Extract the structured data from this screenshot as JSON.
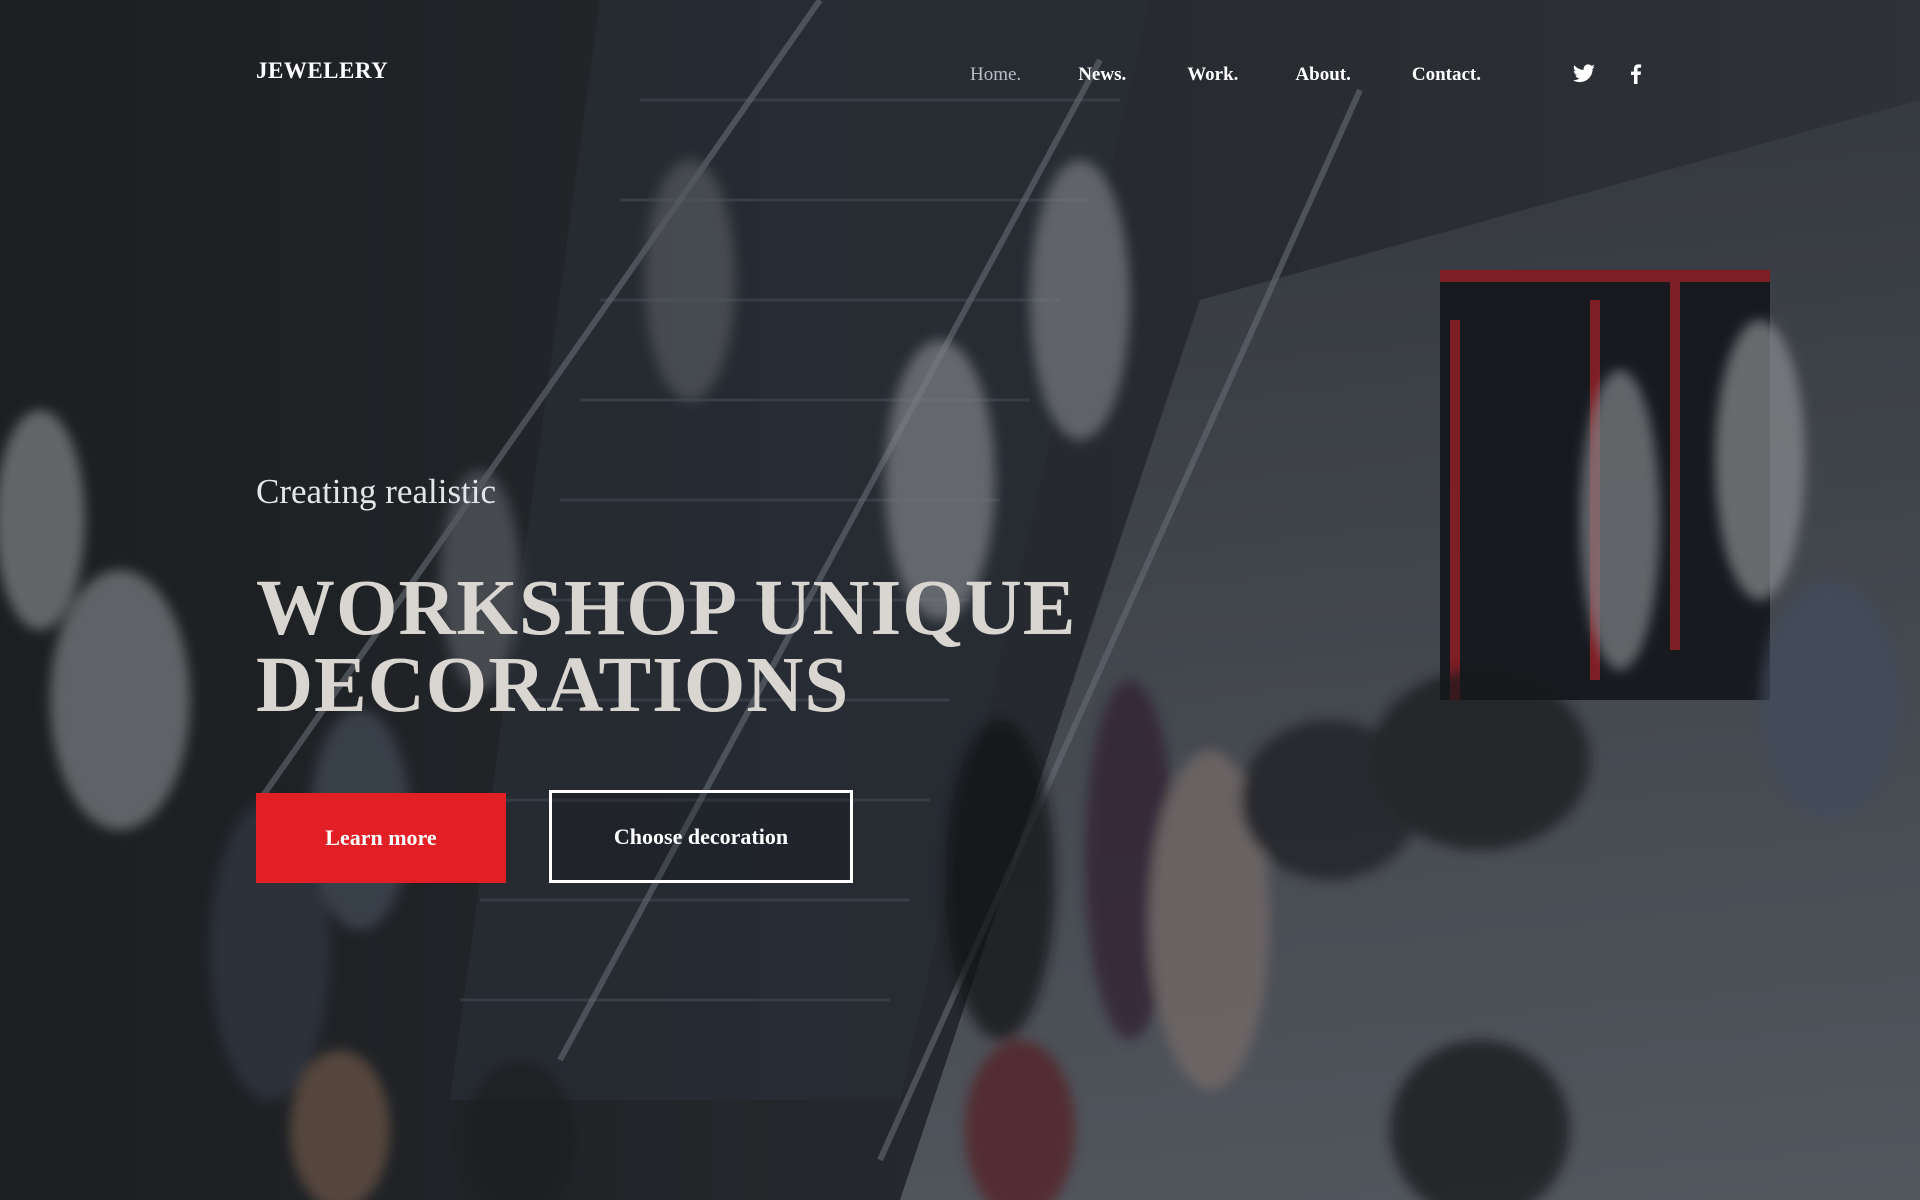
{
  "brand": {
    "logo_text": "JEWELERY"
  },
  "nav": {
    "items": [
      {
        "label": "Home.",
        "active": true
      },
      {
        "label": "News.",
        "active": false
      },
      {
        "label": "Work.",
        "active": false
      },
      {
        "label": "About.",
        "active": false
      },
      {
        "label": "Contact.",
        "active": false
      }
    ]
  },
  "social": {
    "icons": [
      "twitter-icon",
      "facebook-icon"
    ]
  },
  "hero": {
    "subtitle": "Creating realistic",
    "headline_line1": "WORKSHOP UNIQUE",
    "headline_line2": "DECORATIONS",
    "primary_button": "Learn more",
    "secondary_button": "Choose decoration"
  },
  "colors": {
    "accent": "#e31f26",
    "text_light": "#ffffff",
    "nav_active": "#b9bec6",
    "headline": "#d9d5d0"
  }
}
